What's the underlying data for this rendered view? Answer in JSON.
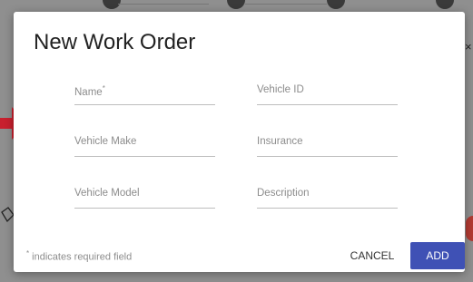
{
  "dialog": {
    "title": "New Work Order",
    "fields": [
      {
        "label": "Name",
        "required_mark": "*"
      },
      {
        "label": "Vehicle ID"
      },
      {
        "label": "Vehicle Make"
      },
      {
        "label": "Insurance"
      },
      {
        "label": "Vehicle Model"
      },
      {
        "label": "Description"
      }
    ],
    "footnote": {
      "star": "*",
      "text": " indicates required field"
    },
    "buttons": {
      "cancel": "CANCEL",
      "add": "ADD"
    }
  },
  "background": {
    "close_glyph": "×"
  },
  "colors": {
    "primary": "#3f51b5",
    "accent_red": "#c8202e",
    "scrim": "#8f8f8f"
  }
}
